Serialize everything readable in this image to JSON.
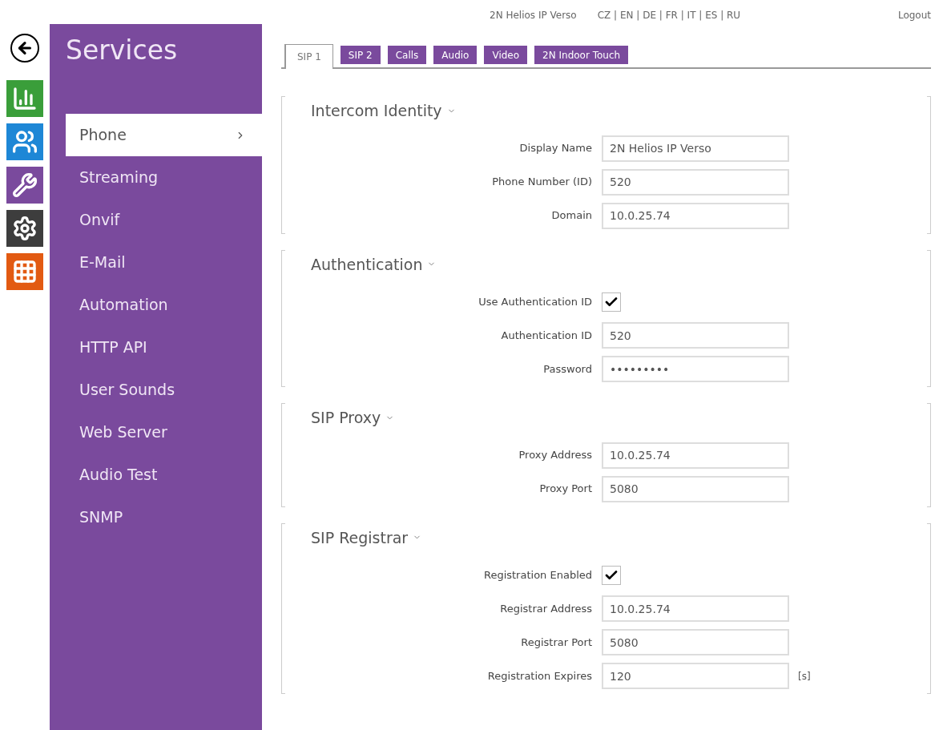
{
  "top_bar": {
    "device": "2N Helios IP Verso",
    "languages": "CZ | EN | DE | FR | IT | ES | RU",
    "logout": "Logout"
  },
  "nav_icons": [
    {
      "kind": "status",
      "color": "#3a9e3a"
    },
    {
      "kind": "directory",
      "color": "#1e87d6"
    },
    {
      "kind": "hardware",
      "color": "#7a4a9d"
    },
    {
      "kind": "system",
      "color": "#3d3d3d"
    },
    {
      "kind": "services",
      "color": "#e25a12"
    }
  ],
  "sidebar": {
    "title": "Services",
    "items": [
      {
        "label": "Phone",
        "selected": true
      },
      {
        "label": "Streaming",
        "selected": false
      },
      {
        "label": "Onvif",
        "selected": false
      },
      {
        "label": "E-Mail",
        "selected": false
      },
      {
        "label": "Automation",
        "selected": false
      },
      {
        "label": "HTTP API",
        "selected": false
      },
      {
        "label": "User Sounds",
        "selected": false
      },
      {
        "label": "Web Server",
        "selected": false
      },
      {
        "label": "Audio Test",
        "selected": false
      },
      {
        "label": "SNMP",
        "selected": false
      }
    ]
  },
  "tabs": [
    {
      "label": "SIP 1",
      "selected": true
    },
    {
      "label": "SIP 2",
      "selected": false
    },
    {
      "label": "Calls",
      "selected": false
    },
    {
      "label": "Audio",
      "selected": false
    },
    {
      "label": "Video",
      "selected": false
    },
    {
      "label": "2N Indoor Touch",
      "selected": false
    }
  ],
  "sections": [
    {
      "title": "Intercom Identity",
      "fields": [
        {
          "kind": "text",
          "label": "Display Name",
          "value": "2N Helios IP Verso"
        },
        {
          "kind": "text",
          "label": "Phone Number (ID)",
          "value": "520"
        },
        {
          "kind": "text",
          "label": "Domain",
          "value": "10.0.25.74"
        }
      ]
    },
    {
      "title": "Authentication",
      "fields": [
        {
          "kind": "checkbox",
          "label": "Use Authentication ID",
          "checked": true
        },
        {
          "kind": "text",
          "label": "Authentication ID",
          "value": "520"
        },
        {
          "kind": "text",
          "label": "Password",
          "value": "•••••••••"
        }
      ]
    },
    {
      "title": "SIP Proxy",
      "fields": [
        {
          "kind": "text",
          "label": "Proxy Address",
          "value": "10.0.25.74"
        },
        {
          "kind": "text",
          "label": "Proxy Port",
          "value": "5080"
        }
      ]
    },
    {
      "title": "SIP Registrar",
      "fields": [
        {
          "kind": "checkbox",
          "label": "Registration Enabled",
          "checked": true
        },
        {
          "kind": "text",
          "label": "Registrar Address",
          "value": "10.0.25.74"
        },
        {
          "kind": "text",
          "label": "Registrar Port",
          "value": "5080"
        },
        {
          "kind": "text",
          "label": "Registration Expires",
          "value": "120",
          "unit": "[s]"
        }
      ]
    }
  ]
}
